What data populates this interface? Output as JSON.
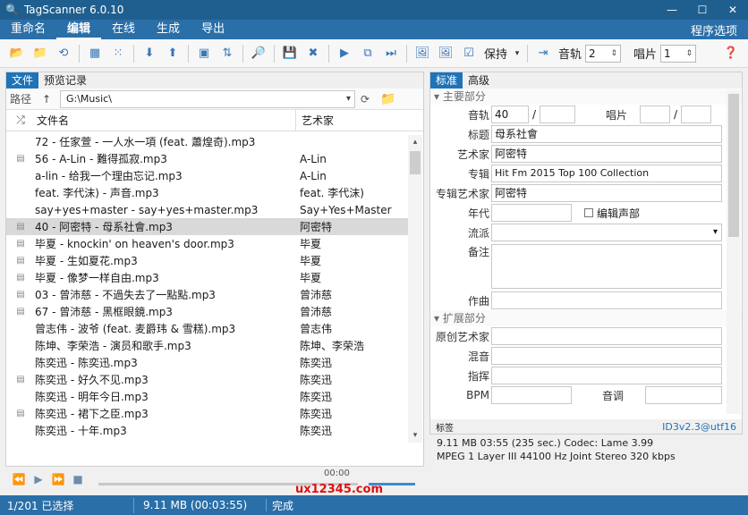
{
  "window": {
    "title": "TagScanner 6.0.10"
  },
  "menu": {
    "tabs": [
      "重命名",
      "编辑",
      "在线",
      "生成",
      "导出"
    ],
    "active": "编辑",
    "right": "程序选项"
  },
  "toolbar": {
    "keep_label": "保持",
    "track_label": "音轨",
    "track_value": "2",
    "disc_label": "唱片",
    "disc_value": "1"
  },
  "left": {
    "tabs": [
      "文件",
      "预览记录"
    ],
    "path_label": "路径",
    "path_value": "G:\\Music\\",
    "col_name": "文件名",
    "col_artist": "艺术家",
    "files": [
      {
        "name": "72 - 任家萱 - 一人水一項 (feat. 蕭煌奇).mp3",
        "artist": "",
        "icon": false,
        "selected": false
      },
      {
        "name": "56 - A-Lin - 難得孤寂.mp3",
        "artist": "A-Lin",
        "icon": true,
        "selected": false
      },
      {
        "name": "a-lin - 给我一个理由忘记.mp3",
        "artist": "A-Lin",
        "icon": false,
        "selected": false
      },
      {
        "name": "feat. 李代沫) - 声音.mp3",
        "artist": "feat. 李代沫)",
        "icon": false,
        "selected": false
      },
      {
        "name": "say+yes+master - say+yes+master.mp3",
        "artist": "Say+Yes+Master",
        "icon": false,
        "selected": false
      },
      {
        "name": "40 - 阿密特 - 母系社會.mp3",
        "artist": "阿密特",
        "icon": true,
        "selected": true
      },
      {
        "name": "毕夏 - knockin' on heaven's door.mp3",
        "artist": "毕夏",
        "icon": true,
        "selected": false
      },
      {
        "name": "毕夏 - 生如夏花.mp3",
        "artist": "毕夏",
        "icon": true,
        "selected": false
      },
      {
        "name": "毕夏 - 像梦一样自由.mp3",
        "artist": "毕夏",
        "icon": true,
        "selected": false
      },
      {
        "name": "03 - 曾沛慈 - 不過失去了一點點.mp3",
        "artist": "曾沛慈",
        "icon": true,
        "selected": false
      },
      {
        "name": "67 - 曾沛慈 - 黑框眼鏡.mp3",
        "artist": "曾沛慈",
        "icon": true,
        "selected": false
      },
      {
        "name": "曾志伟 - 波爷 (feat. 麦爵玮 & 雪糕).mp3",
        "artist": "曾志伟",
        "icon": false,
        "selected": false
      },
      {
        "name": "陈坤、李荣浩 - 演员和歌手.mp3",
        "artist": "陈坤、李荣浩",
        "icon": false,
        "selected": false
      },
      {
        "name": "陈奕迅 - 陈奕迅.mp3",
        "artist": "陈奕迅",
        "icon": false,
        "selected": false
      },
      {
        "name": "陈奕迅 - 好久不见.mp3",
        "artist": "陈奕迅",
        "icon": true,
        "selected": false
      },
      {
        "name": "陈奕迅 - 明年今日.mp3",
        "artist": "陈奕迅",
        "icon": false,
        "selected": false
      },
      {
        "name": "陈奕迅 - 裙下之臣.mp3",
        "artist": "陈奕迅",
        "icon": true,
        "selected": false
      },
      {
        "name": "陈奕迅 - 十年.mp3",
        "artist": "陈奕迅",
        "icon": false,
        "selected": false
      }
    ]
  },
  "player": {
    "time": "00:00"
  },
  "right": {
    "tabs": [
      "标准",
      "高级"
    ],
    "section_main": "主要部分",
    "section_ext": "扩展部分",
    "track_label": "音轨",
    "track_value": "40",
    "disc_label": "唱片",
    "title_label": "标题",
    "title_value": "母系社會",
    "artist_label": "艺术家",
    "artist_value": "阿密特",
    "album_label": "专辑",
    "album_value": "Hit Fm 2015 Top 100 Collection",
    "albumartist_label": "专辑艺术家",
    "albumartist_value": "阿密特",
    "year_label": "年代",
    "edit_cover_label": "编辑声部",
    "genre_label": "流派",
    "comment_label": "备注",
    "composer_label": "作曲",
    "orig_artist_label": "原创艺术家",
    "remix_label": "混音",
    "conductor_label": "指挥",
    "bpm_label": "BPM",
    "key_label": "音调",
    "foot_left": "标签",
    "foot_tag": "ID3v2.3@utf16"
  },
  "info": {
    "line1": "9.11 MB  03:55 (235 sec.)  Codec: Lame 3.99",
    "line2": "MPEG 1 Layer III  44100 Hz  Joint Stereo  320 kbps"
  },
  "status": {
    "selected": "1/201 已选择",
    "size": "9.11 MB (00:03:55)",
    "state": "完成"
  },
  "watermark": "ux12345.com"
}
